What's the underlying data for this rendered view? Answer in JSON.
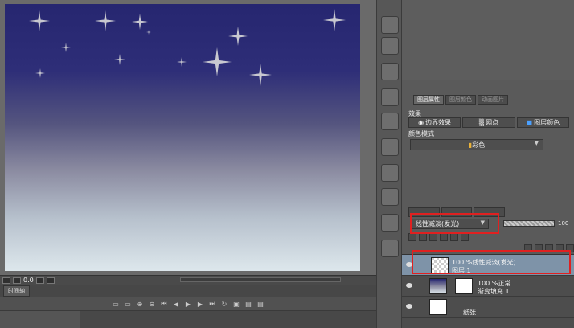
{
  "layer_property_panel": {
    "tabs": [
      "图层属性",
      "图层颜色",
      "动画图片"
    ],
    "effect_label": "效果",
    "effect_buttons": [
      "边界效果",
      "网点",
      "图层颜色"
    ],
    "color_mode_label": "颜色模式",
    "color_mode_value": "彩色"
  },
  "layer_panel": {
    "blend_mode": "线性减淡(发光)",
    "opacity": "100",
    "layers": [
      {
        "mode": "100 %线性减淡(发光)",
        "name": "图层 1",
        "selected": true
      },
      {
        "mode": "100 %正常",
        "name": "渐变填充 1",
        "selected": false
      },
      {
        "mode": "",
        "name": "纸张",
        "selected": false
      }
    ]
  },
  "canvas_status": {
    "zoom": "0.0"
  },
  "timeline": {
    "tab_label": "时间轴"
  },
  "colors": {
    "sky_top": "#262670",
    "sky_bottom": "#dde7ec",
    "highlight": "#e02020",
    "selected_layer": "#7e93a8"
  }
}
